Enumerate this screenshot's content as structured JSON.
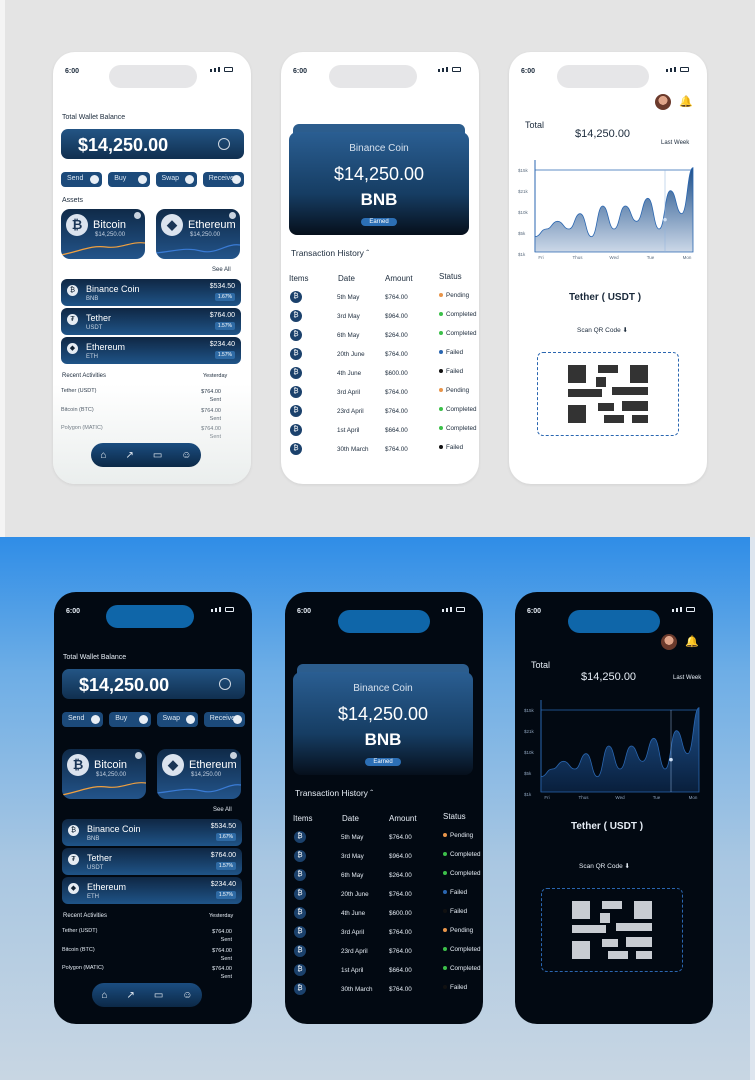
{
  "statusbar": {
    "time": "6:00"
  },
  "wallet": {
    "total_label": "Total Wallet Balance",
    "balance": "$14,250.00",
    "actions": [
      "Send",
      "Buy",
      "Swap",
      "Receive"
    ],
    "assets_label": "Assets",
    "assets": [
      {
        "name": "Bitcoin",
        "value": "$14,250.00"
      },
      {
        "name": "Ethereum",
        "value": "$14,250.00"
      }
    ],
    "see_all": "See All",
    "rows": [
      {
        "name": "Binance Coin",
        "sym": "BNB",
        "price": "$534.50",
        "gain": "1.67%"
      },
      {
        "name": "Tether",
        "sym": "USDT",
        "price": "$764.00",
        "gain": "1.57%"
      },
      {
        "name": "Ethereum",
        "sym": "ETH",
        "price": "$234.40",
        "gain": "1.57%"
      }
    ],
    "recent_label": "Recent Activities",
    "recent_day": "Yesterday",
    "recent": [
      {
        "name": "Tether (USDT)",
        "amount": "$764.00",
        "status": "Sent"
      },
      {
        "name": "Bitcoin (BTC)",
        "amount": "$764.00",
        "status": "Sent"
      },
      {
        "name": "Polygon (MATIC)",
        "amount": "$764.00",
        "status": "Sent"
      }
    ]
  },
  "coin": {
    "name": "Binance Coin",
    "balance": "$14,250.00",
    "symbol": "BNB",
    "badge": "Earned",
    "history_label": "Transaction History",
    "headers": [
      "Items",
      "Date",
      "Amount",
      "Status"
    ],
    "tx": [
      {
        "date": "5th May",
        "amount": "$764.00",
        "status": "Pending",
        "color": "#e8954a"
      },
      {
        "date": "3rd May",
        "amount": "$964.00",
        "status": "Completed",
        "color": "#3cc04a"
      },
      {
        "date": "6th May",
        "amount": "$264.00",
        "status": "Completed",
        "color": "#3cc04a"
      },
      {
        "date": "20th June",
        "amount": "$764.00",
        "status": "Failed",
        "color": "#2a66b0"
      },
      {
        "date": "4th June",
        "amount": "$600.00",
        "status": "Failed",
        "color": "#111111"
      },
      {
        "date": "3rd April",
        "amount": "$764.00",
        "status": "Pending",
        "color": "#e8954a"
      },
      {
        "date": "23rd April",
        "amount": "$764.00",
        "status": "Completed",
        "color": "#3cc04a"
      },
      {
        "date": "1st April",
        "amount": "$664.00",
        "status": "Completed",
        "color": "#3cc04a"
      },
      {
        "date": "30th March",
        "amount": "$764.00",
        "status": "Failed",
        "color": "#111111"
      }
    ]
  },
  "chart_screen": {
    "total_label": "Total",
    "balance": "$14,250.00",
    "period": "Last Week",
    "title": "Tether ( USDT )",
    "scan_label": "Scan QR Code"
  },
  "chart_data": {
    "type": "area",
    "title": "",
    "xlabel": "",
    "ylabel": "",
    "categories": [
      "Fri",
      "Thus",
      "Wed",
      "Tue",
      "Mon"
    ],
    "y_ticks": [
      "$15k",
      "$21k",
      "$10k",
      "$5k",
      "$1k"
    ],
    "values": [
      2,
      3,
      4,
      3,
      5,
      2,
      6,
      3,
      6,
      4,
      7,
      3,
      8,
      5,
      11
    ]
  }
}
